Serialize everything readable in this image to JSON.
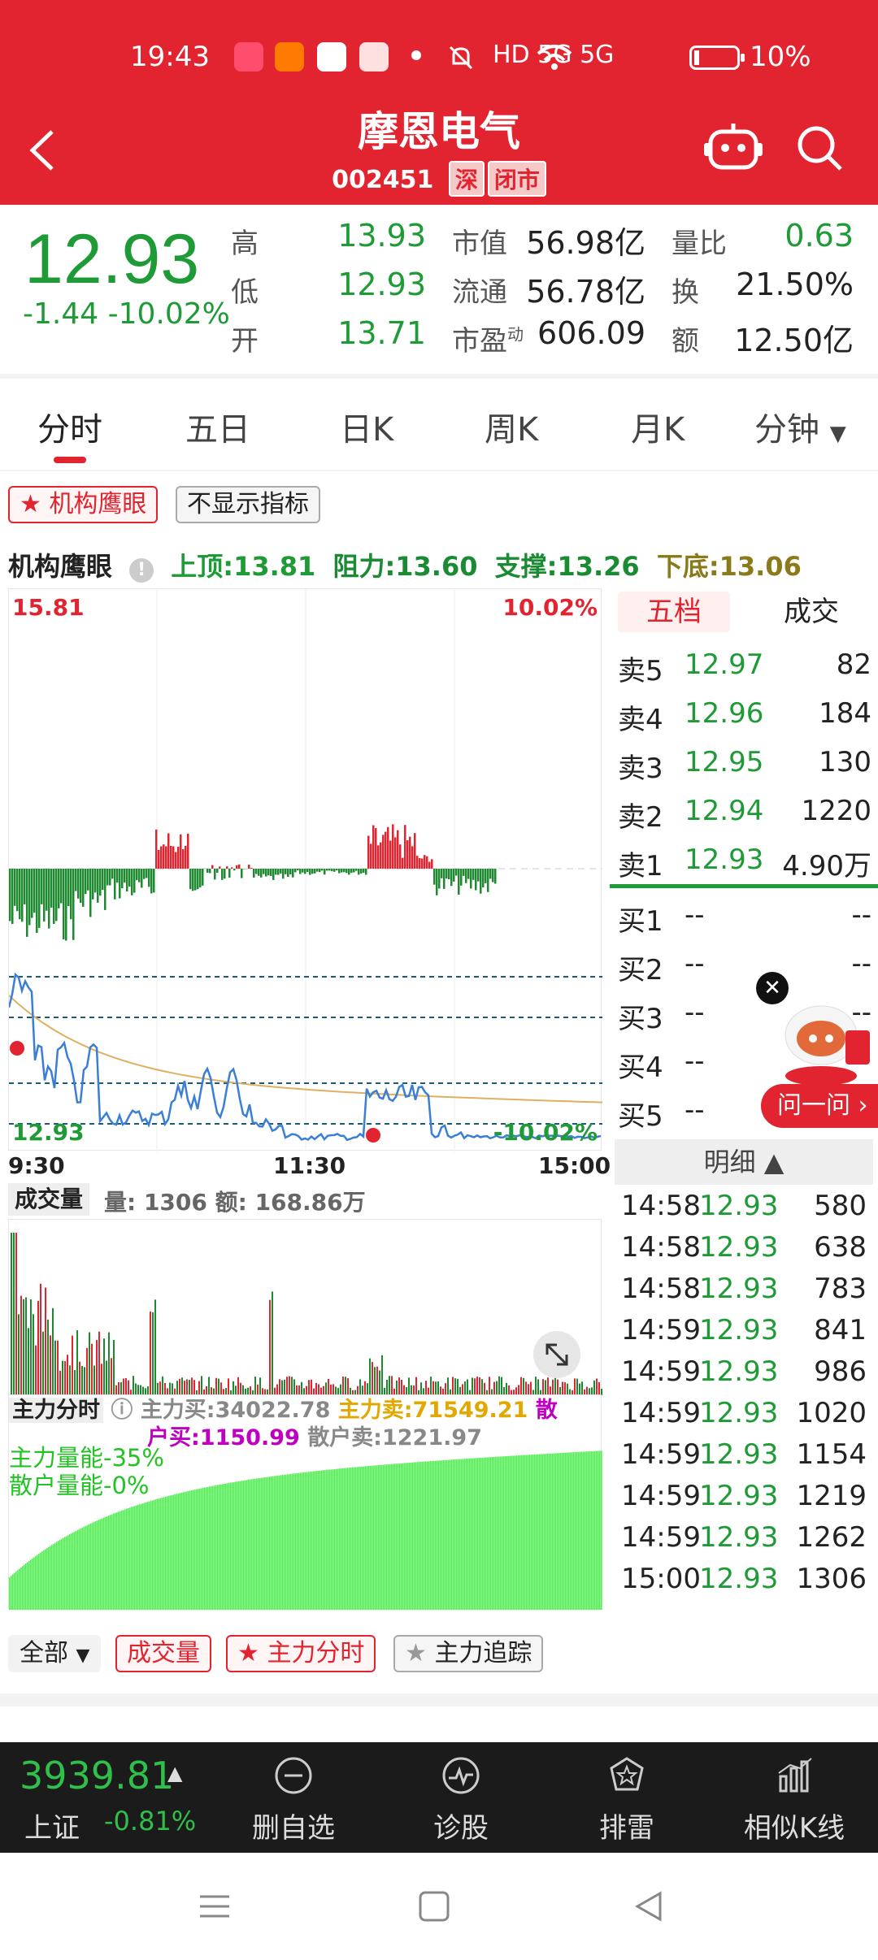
{
  "status_bar": {
    "time": "19:43",
    "signal": "HD 5G 5G",
    "battery": "10%"
  },
  "header": {
    "title": "摩恩电气",
    "code": "002451",
    "tags": [
      "深",
      "闭市"
    ]
  },
  "quote": {
    "price": "12.93",
    "change": "-1.44 -10.02%",
    "rows": [
      {
        "l1": "高",
        "v1": "13.93",
        "l2": "市值",
        "v2": "56.98亿",
        "l3": "量比",
        "v3": "0.63"
      },
      {
        "l1": "低",
        "v1": "12.93",
        "l2": "流通",
        "v2": "56.78亿",
        "l3": "换",
        "v3": "21.50%"
      },
      {
        "l1": "开",
        "v1": "13.71",
        "l2": "市盈",
        "l2sup": "动",
        "v2": "606.09",
        "l3": "额",
        "v3": "12.50亿"
      }
    ]
  },
  "tabs": [
    "分时",
    "五日",
    "日K",
    "周K",
    "月K",
    "分钟"
  ],
  "indicator_pills": [
    "机构鹰眼",
    "不显示指标"
  ],
  "eagle": {
    "title": "机构鹰眼",
    "top": "上顶:13.81",
    "resist": "阻力:13.60",
    "support": "支撑:13.26",
    "bottom": "下底:13.06"
  },
  "price_chart": {
    "high": "15.81",
    "high_pct": "10.02%",
    "low": "12.93",
    "low_pct": "-10.02%",
    "times": [
      "9:30",
      "11:30",
      "15:00"
    ]
  },
  "volume": {
    "label": "成交量",
    "info": "量: 1306 额: 168.86万"
  },
  "main_force": {
    "label": "主力分时",
    "buy": "主力买:34022.78",
    "sell": "主力卖:71549.21",
    "retail_buy_a": "散",
    "retail_buy_b": "户买:1150.99",
    "retail_sell": "散户卖:1221.97",
    "main_energy": "主力量能-35%",
    "retail_energy": "散户量能-0%"
  },
  "order_book": {
    "tabs": [
      "五档",
      "成交"
    ],
    "asks": [
      {
        "label": "卖5",
        "price": "12.97",
        "vol": "82"
      },
      {
        "label": "卖4",
        "price": "12.96",
        "vol": "184"
      },
      {
        "label": "卖3",
        "price": "12.95",
        "vol": "130"
      },
      {
        "label": "卖2",
        "price": "12.94",
        "vol": "1220"
      },
      {
        "label": "卖1",
        "price": "12.93",
        "vol": "4.90万"
      }
    ],
    "bids": [
      {
        "label": "买1",
        "price": "--",
        "vol": "--"
      },
      {
        "label": "买2",
        "price": "--",
        "vol": "--"
      },
      {
        "label": "买3",
        "price": "--",
        "vol": "--"
      },
      {
        "label": "买4",
        "price": "--",
        "vol": ""
      },
      {
        "label": "买5",
        "price": "--",
        "vol": ""
      }
    ]
  },
  "ask_widget": {
    "label": "问一问 ›"
  },
  "detail": {
    "label": "明细 ▲",
    "rows": [
      {
        "t": "14:58",
        "p": "12.93",
        "v": "580"
      },
      {
        "t": "14:58",
        "p": "12.93",
        "v": "638"
      },
      {
        "t": "14:58",
        "p": "12.93",
        "v": "783"
      },
      {
        "t": "14:59",
        "p": "12.93",
        "v": "841"
      },
      {
        "t": "14:59",
        "p": "12.93",
        "v": "986"
      },
      {
        "t": "14:59",
        "p": "12.93",
        "v": "1020"
      },
      {
        "t": "14:59",
        "p": "12.93",
        "v": "1154"
      },
      {
        "t": "14:59",
        "p": "12.93",
        "v": "1219"
      },
      {
        "t": "14:59",
        "p": "12.93",
        "v": "1262"
      },
      {
        "t": "15:00",
        "p": "12.93",
        "v": "1306"
      }
    ]
  },
  "bottom_pills": [
    "全部",
    "成交量",
    "主力分时",
    "主力追踪"
  ],
  "bottom_bar": {
    "index_value": "3939.81",
    "index_name": "上证",
    "index_change": "-0.81%",
    "items": [
      "删自选",
      "诊股",
      "排雷",
      "相似K线"
    ]
  },
  "colors": {
    "brand": "#e1242f",
    "down": "#1e9a36",
    "up": "#e1242f"
  }
}
